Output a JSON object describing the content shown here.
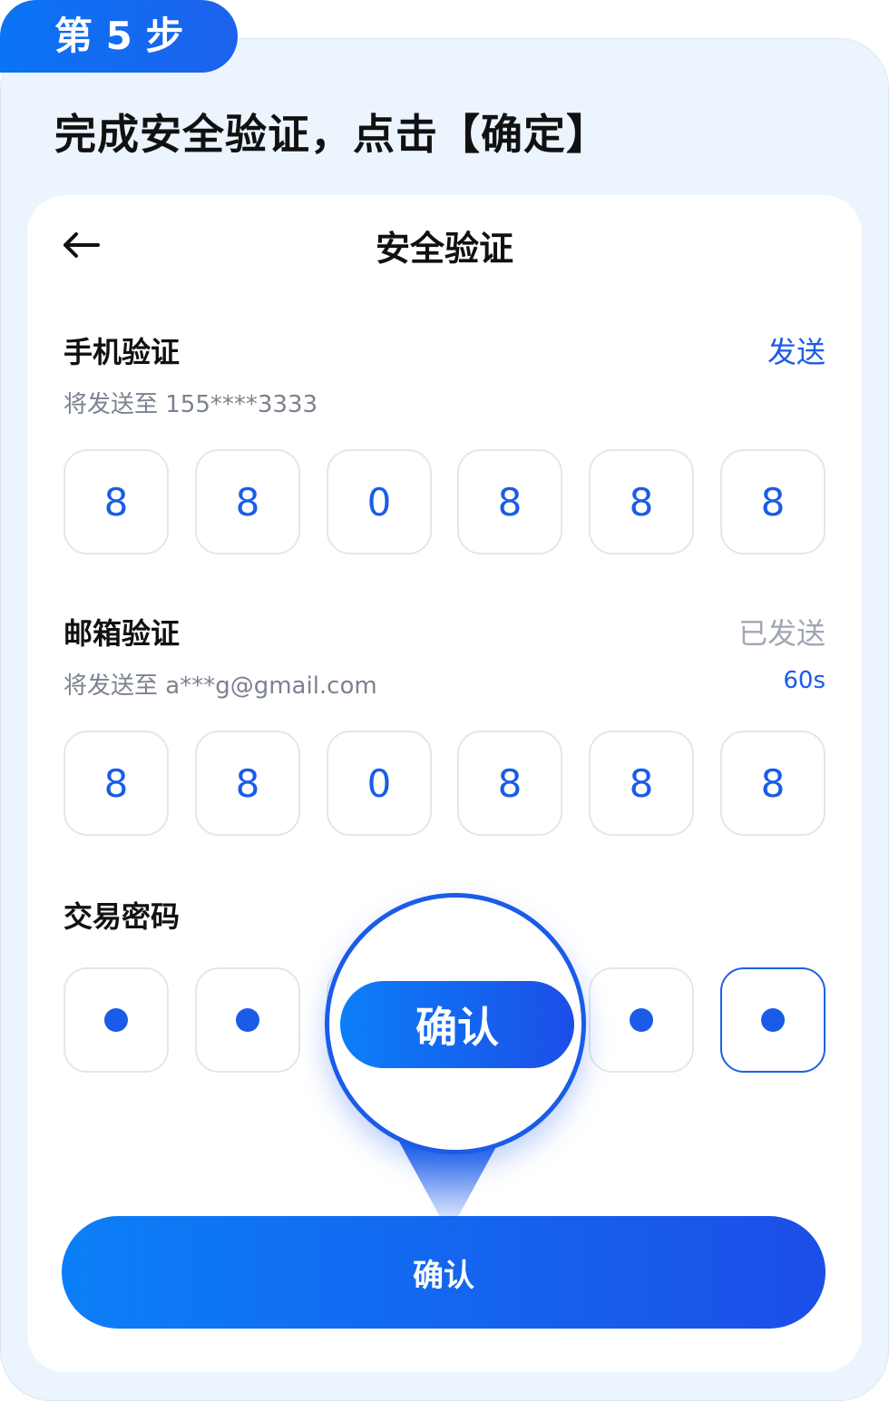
{
  "step": {
    "label": "第 5 步"
  },
  "heading": "完成安全验证，点击【确定】",
  "screen": {
    "title": "安全验证",
    "back_icon": "arrow-left-icon"
  },
  "phone": {
    "label": "手机验证",
    "action": "发送",
    "hint": "将发送至 155****3333",
    "code": [
      "8",
      "8",
      "0",
      "8",
      "8",
      "8"
    ]
  },
  "email": {
    "label": "邮箱验证",
    "action": "已发送",
    "hint": "将发送至 a***g@gmail.com",
    "timer": "60s",
    "code": [
      "8",
      "8",
      "0",
      "8",
      "8",
      "8"
    ]
  },
  "password": {
    "label": "交易密码",
    "length": 6
  },
  "confirm_button": {
    "label": "确认"
  },
  "callout_button": {
    "label": "确认"
  },
  "colors": {
    "accent": "#1a5ce8",
    "gradient_start": "#0b7ff7",
    "gradient_end": "#1c4ee8",
    "muted": "#a1a6b3",
    "panel_bg": "#ecf5fe"
  }
}
